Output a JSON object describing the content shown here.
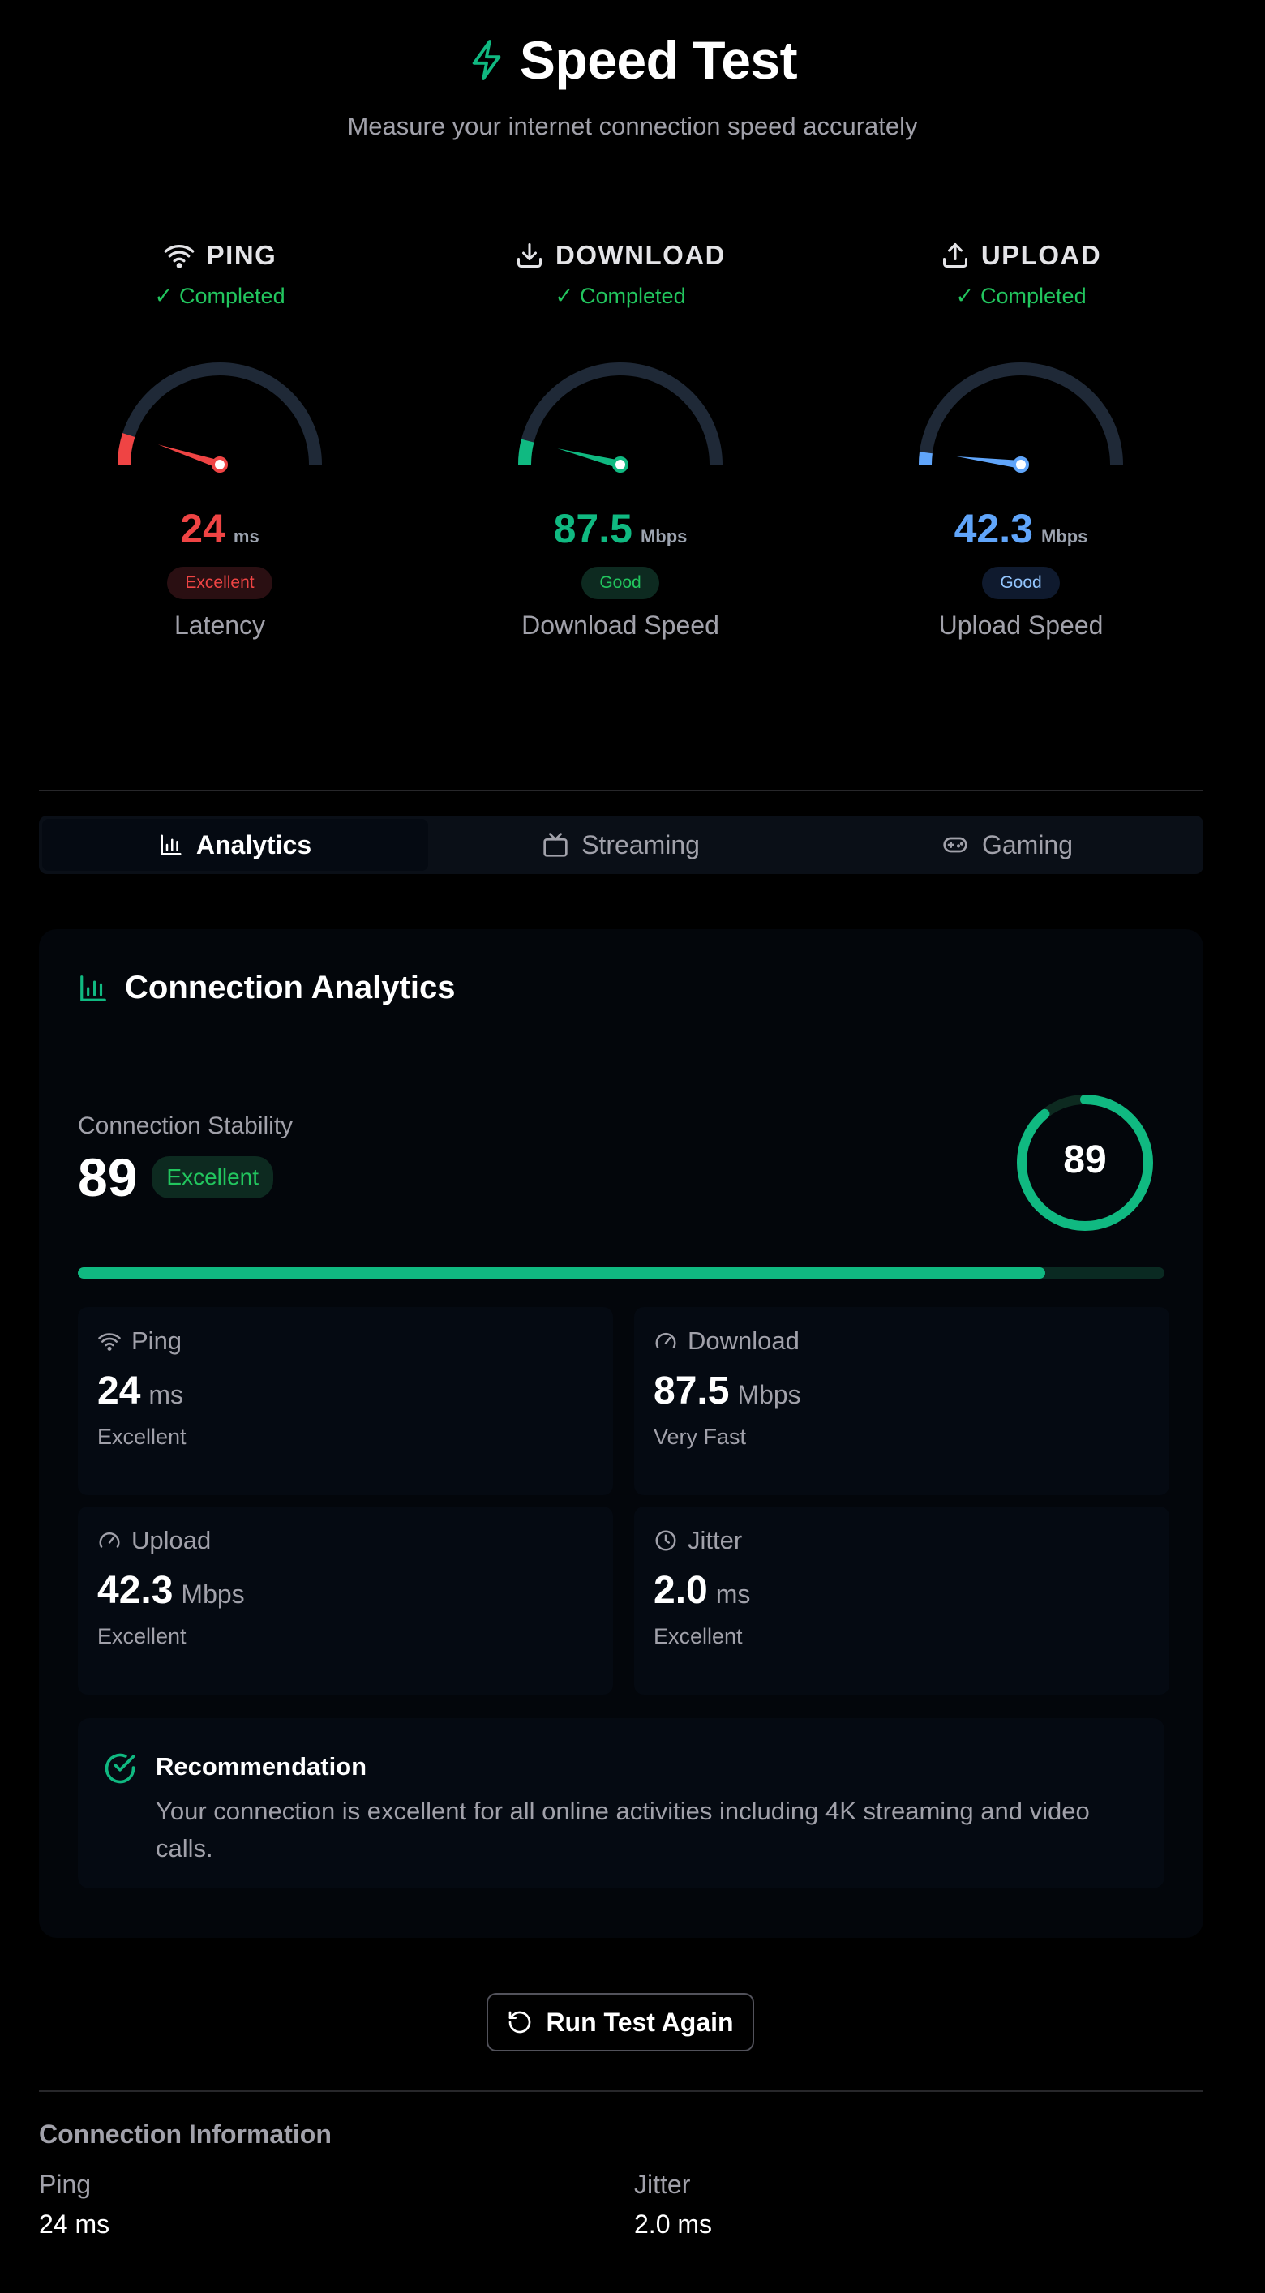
{
  "header": {
    "title": "Speed Test",
    "subtitle": "Measure your internet connection speed accurately",
    "icon": "lightning-icon",
    "accent_color": "#10b981"
  },
  "gauges": [
    {
      "id": "ping",
      "name": "PING",
      "icon": "wifi-icon",
      "status": "Completed",
      "value": "24",
      "unit": "ms",
      "rating": "Excellent",
      "label": "Latency",
      "color": "#ef4444",
      "pill_bg": "#2a0f12",
      "level": 0.1
    },
    {
      "id": "download",
      "name": "DOWNLOAD",
      "icon": "download-icon",
      "status": "Completed",
      "value": "87.5",
      "unit": "Mbps",
      "rating": "Good",
      "label": "Download Speed",
      "color": "#10b981",
      "pill_bg": "#0d2a20",
      "level": 0.08
    },
    {
      "id": "upload",
      "name": "UPLOAD",
      "icon": "upload-icon",
      "status": "Completed",
      "value": "42.3",
      "unit": "Mbps",
      "rating": "Good",
      "label": "Upload Speed",
      "color": "#60a5fa",
      "pill_bg": "#0f1a2e",
      "level": 0.04
    }
  ],
  "tabs": [
    {
      "label": "Analytics",
      "icon": "bar-chart-icon",
      "active": true
    },
    {
      "label": "Streaming",
      "icon": "tv-icon",
      "active": false
    },
    {
      "label": "Gaming",
      "icon": "gamepad-icon",
      "active": false
    }
  ],
  "analytics": {
    "title": "Connection Analytics",
    "stability_label": "Connection Stability",
    "stability_value": "89",
    "stability_rating": "Excellent",
    "stability_percent": 89,
    "metrics": [
      {
        "icon": "wifi-icon",
        "label": "Ping",
        "value": "24",
        "unit": "ms",
        "sub": "Excellent"
      },
      {
        "icon": "gauge-icon",
        "label": "Download",
        "value": "87.5",
        "unit": "Mbps",
        "sub": "Very Fast"
      },
      {
        "icon": "gauge-icon",
        "label": "Upload",
        "value": "42.3",
        "unit": "Mbps",
        "sub": "Excellent"
      },
      {
        "icon": "clock-icon",
        "label": "Jitter",
        "value": "2.0",
        "unit": "ms",
        "sub": "Excellent"
      }
    ],
    "recommendation_title": "Recommendation",
    "recommendation_text": "Your connection is excellent for all online activities including 4K streaming and video calls."
  },
  "run_button": {
    "label": "Run Test Again",
    "icon": "refresh-icon"
  },
  "info": {
    "title": "Connection Information",
    "items": [
      {
        "key": "Ping",
        "value": "24 ms"
      },
      {
        "key": "Jitter",
        "value": "2.0 ms"
      }
    ]
  }
}
